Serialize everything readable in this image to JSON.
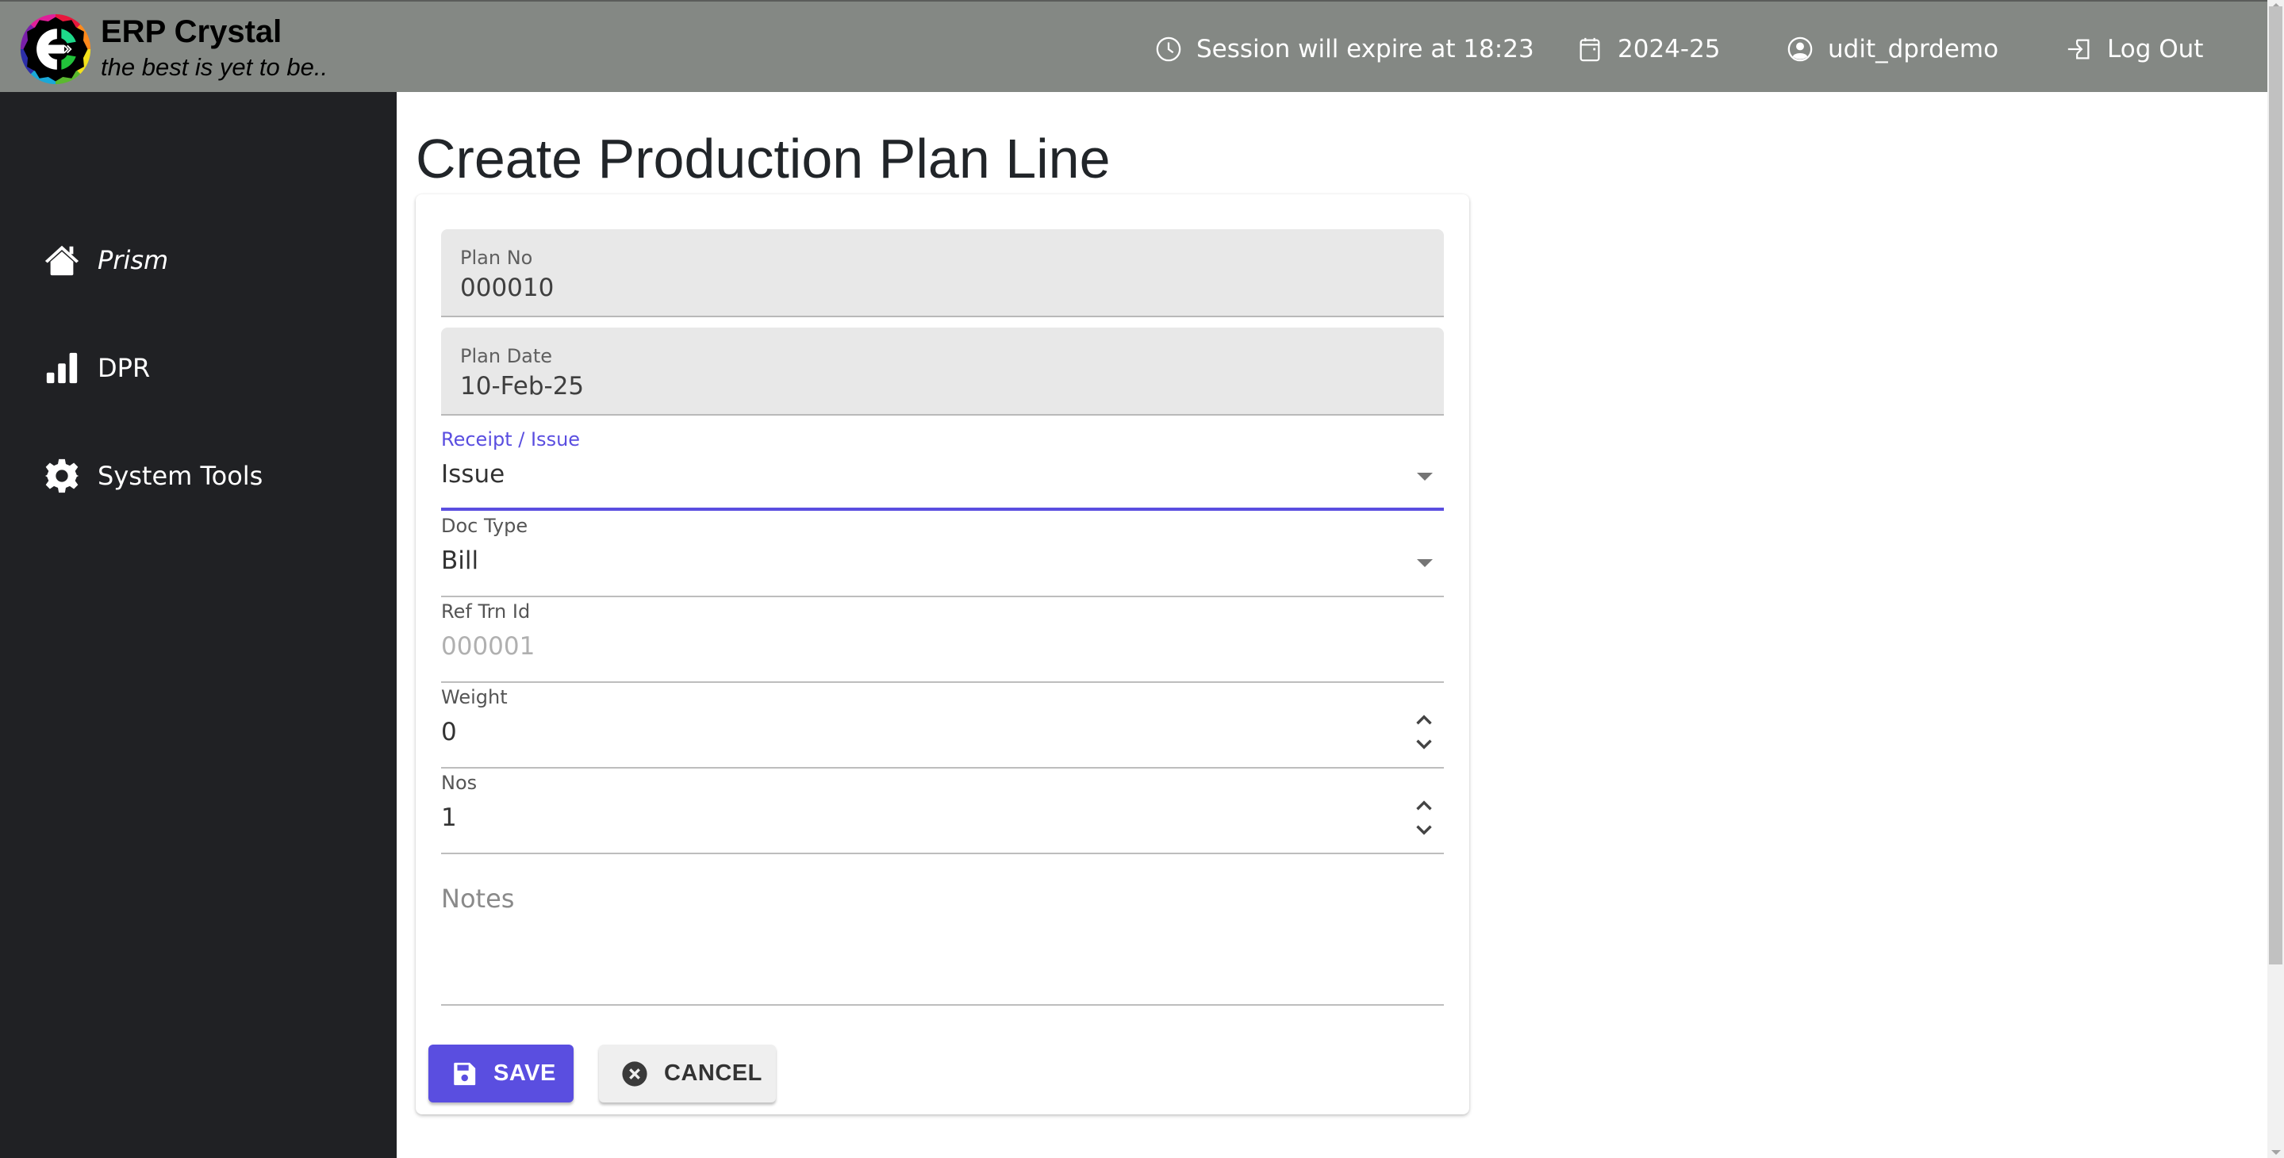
{
  "header": {
    "brand_title": "ERP Crystal",
    "brand_tagline": "the best is yet to be..",
    "session_text": "Session will expire at 18:23",
    "financial_year": "2024-25",
    "username": "udit_dprdemo",
    "logout_label": "Log Out",
    "icons": {
      "session": "clock-icon",
      "year": "calendar-icon",
      "user": "user-circle-icon",
      "logout": "logout-icon"
    }
  },
  "sidebar": {
    "items": [
      {
        "label": "Prism",
        "icon": "home-icon"
      },
      {
        "label": "DPR",
        "icon": "bar-chart-icon"
      },
      {
        "label": "System Tools",
        "icon": "gear-icon"
      }
    ]
  },
  "page": {
    "title": "Create Production Plan Line"
  },
  "form": {
    "plan_no": {
      "label": "Plan No",
      "value": "000010"
    },
    "plan_date": {
      "label": "Plan Date",
      "value": "10-Feb-25"
    },
    "receipt_issue": {
      "label": "Receipt / Issue",
      "value": "Issue"
    },
    "doc_type": {
      "label": "Doc Type",
      "value": "Bill"
    },
    "ref_trn_id": {
      "label": "Ref Trn Id",
      "placeholder": "000001",
      "value": ""
    },
    "weight": {
      "label": "Weight",
      "value": "0"
    },
    "nos": {
      "label": "Nos",
      "value": "1"
    },
    "notes": {
      "placeholder": "Notes",
      "value": ""
    }
  },
  "actions": {
    "save_label": "SAVE",
    "cancel_label": "CANCEL"
  },
  "colors": {
    "header_bg": "#848884",
    "sidebar_bg": "#202124",
    "accent": "#5a4ee0",
    "cancel_bg": "#efefef"
  }
}
